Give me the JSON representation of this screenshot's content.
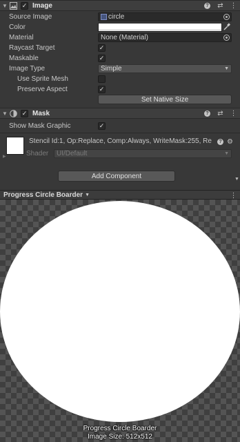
{
  "image_component": {
    "title": "Image",
    "enabled": true,
    "fields": {
      "source_image_label": "Source Image",
      "source_image_value": "circle",
      "color_label": "Color",
      "color_value": "#ffffff",
      "material_label": "Material",
      "material_value": "None (Material)",
      "raycast_target_label": "Raycast Target",
      "raycast_target": true,
      "maskable_label": "Maskable",
      "maskable": true,
      "image_type_label": "Image Type",
      "image_type_value": "Simple",
      "use_sprite_mesh_label": "Use Sprite Mesh",
      "use_sprite_mesh": false,
      "preserve_aspect_label": "Preserve Aspect",
      "preserve_aspect": true
    },
    "set_native_size_label": "Set Native Size"
  },
  "mask_component": {
    "title": "Mask",
    "enabled": true,
    "show_mask_graphic_label": "Show Mask Graphic",
    "show_mask_graphic": true
  },
  "material_preview": {
    "name": "Stencil Id:1, Op:Replace, Comp:Always, WriteMask:255, Re",
    "shader_label": "Shader",
    "shader_value": "UI/Default"
  },
  "add_component_label": "Add Component",
  "preview": {
    "title": "Progress Circle Boarder",
    "caption_name": "Progress Circle Boarder",
    "caption_size": "Image Size: 512x512"
  },
  "colors": {
    "panel_bg": "#383838",
    "header_bg": "#3e3e3e",
    "field_bg": "#2a2a2a",
    "button_bg": "#585858"
  }
}
